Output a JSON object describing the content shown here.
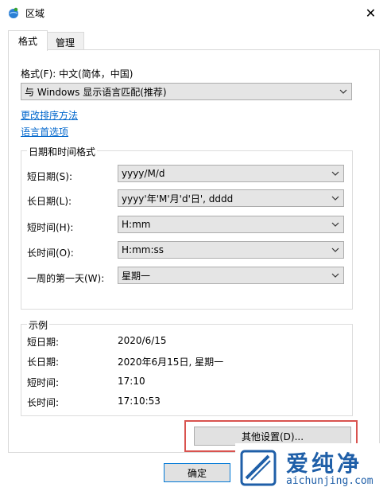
{
  "window": {
    "title": "区域"
  },
  "tabs": [
    {
      "label": "格式",
      "active": true
    },
    {
      "label": "管理",
      "active": false
    }
  ],
  "format": {
    "label": "格式(F): 中文(简体，中国)",
    "value": "与 Windows 显示语言匹配(推荐)"
  },
  "links": {
    "sort": "更改排序方法",
    "lang_pref": "语言首选项"
  },
  "datetime": {
    "group_title": "日期和时间格式",
    "rows": [
      {
        "label": "短日期(S):",
        "value": "yyyy/M/d"
      },
      {
        "label": "长日期(L):",
        "value": "yyyy'年'M'月'd'日', dddd"
      },
      {
        "label": "短时间(H):",
        "value": "H:mm"
      },
      {
        "label": "长时间(O):",
        "value": "H:mm:ss"
      },
      {
        "label": "一周的第一天(W):",
        "value": "星期一"
      }
    ]
  },
  "examples": {
    "group_title": "示例",
    "rows": [
      {
        "label": "短日期:",
        "value": "2020/6/15"
      },
      {
        "label": "长日期:",
        "value": "2020年6月15日, 星期一"
      },
      {
        "label": "短时间:",
        "value": "17:10"
      },
      {
        "label": "长时间:",
        "value": "17:10:53"
      }
    ]
  },
  "buttons": {
    "other_settings": "其他设置(D)...",
    "ok": "确定"
  },
  "watermark": {
    "brand": "爱纯净",
    "url": "aichunjing.com"
  },
  "colors": {
    "link": "#0066cc",
    "highlight": "#d9534f",
    "watermark_blue": "#1f5fa8"
  }
}
